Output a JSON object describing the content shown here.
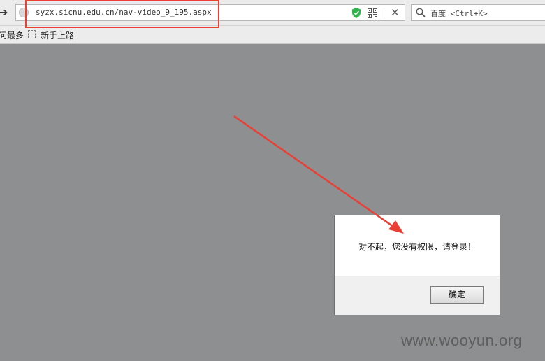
{
  "address_bar": {
    "url": "syzx.sicnu.edu.cn/nav-video_9_195.aspx"
  },
  "search_bar": {
    "engine": "百度",
    "shortcut": "<Ctrl+K>"
  },
  "bookmarks": {
    "items": [
      {
        "label": "访问最多"
      },
      {
        "label": "新手上路"
      }
    ]
  },
  "dialog": {
    "message": "对不起，您没有权限，请登录！",
    "ok_label": "确定"
  },
  "watermark": "www.wooyun.org",
  "colors": {
    "annotation": "#ea3f35",
    "shield": "#2fb34a"
  }
}
